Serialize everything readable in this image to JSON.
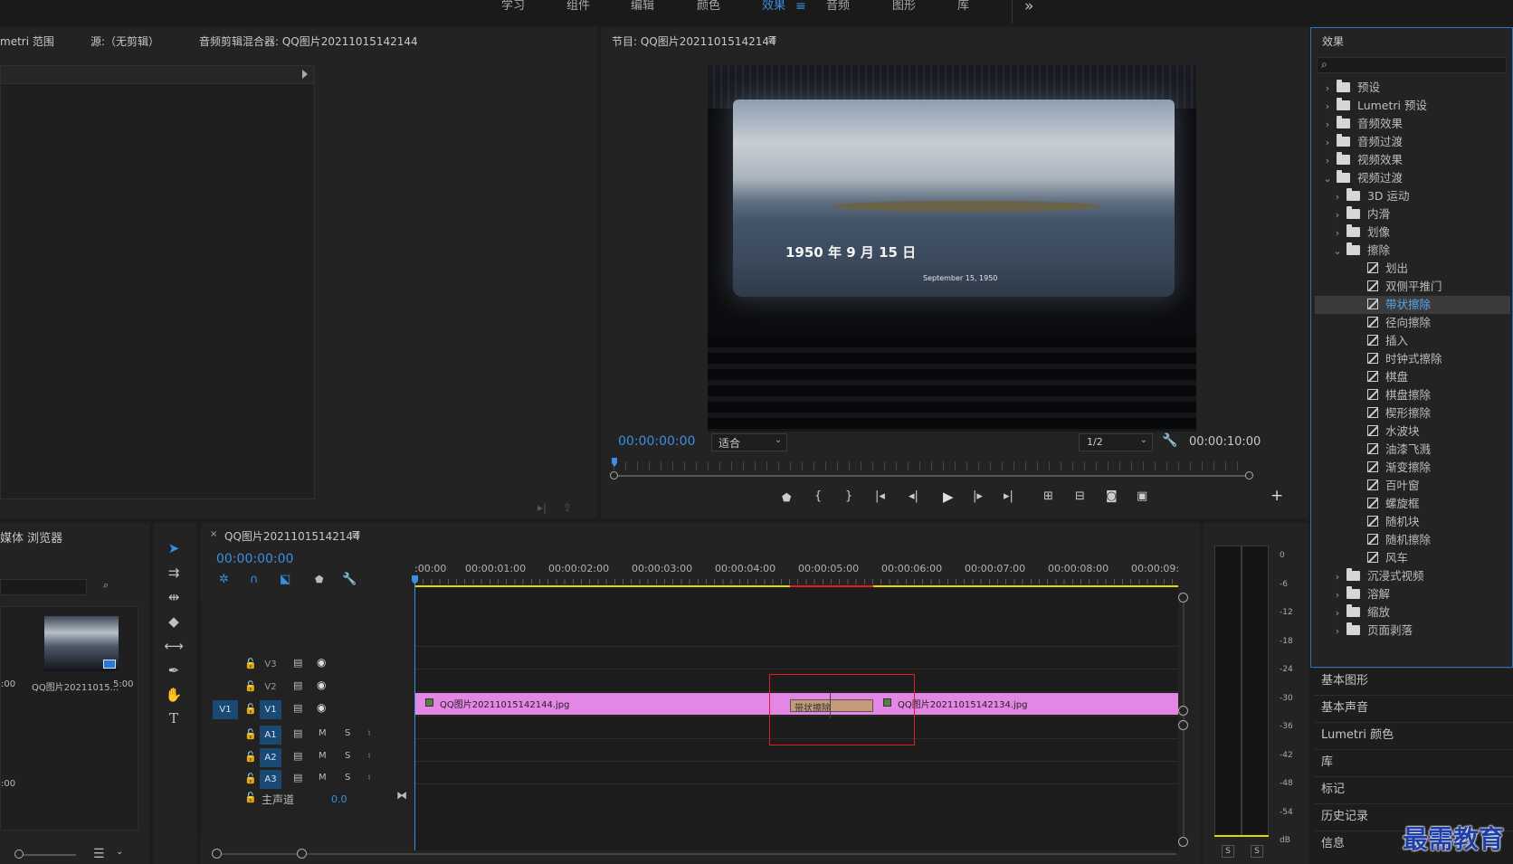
{
  "workspace_tabs": [
    {
      "label": "学习",
      "active": false
    },
    {
      "label": "组件",
      "active": false
    },
    {
      "label": "编辑",
      "active": false
    },
    {
      "label": "颜色",
      "active": false
    },
    {
      "label": "效果",
      "active": true
    },
    {
      "label": "音频",
      "active": false
    },
    {
      "label": "图形",
      "active": false
    },
    {
      "label": "库",
      "active": false
    }
  ],
  "workspace_overflow": "»",
  "source_panel": {
    "tabs": [
      "metri 范围",
      "源:（无剪辑）",
      "音频剪辑混合器: QQ图片20211015142144"
    ]
  },
  "program_monitor": {
    "title": "节目: QQ图片20211015142144",
    "timecode": "00:00:00:00",
    "duration": "00:00:10:00",
    "fit": "适合",
    "resolution": "1/2",
    "video_caption_zh": "1950 年 9 月 15 日",
    "video_caption_en": "September 15, 1950"
  },
  "media_browser": {
    "title": "媒体 浏览器",
    "thumb_label": "QQ图片20211015...",
    "thumb_duration": "5:00",
    "left_label_1": ":00",
    "left_label_2": ":00"
  },
  "timeline": {
    "sequence_name": "QQ图片20211015142144",
    "timecode": "00:00:00:00",
    "ruler": [
      ":00:00",
      "00:00:01:00",
      "00:00:02:00",
      "00:00:03:00",
      "00:00:04:00",
      "00:00:05:00",
      "00:00:06:00",
      "00:00:07:00",
      "00:00:08:00",
      "00:00:09:"
    ],
    "video_tracks": [
      "V3",
      "V2",
      "V1"
    ],
    "audio_tracks": [
      "A1",
      "A2",
      "A3"
    ],
    "source_patch_v": "V1",
    "master_label": "主声道",
    "master_value": "0.0",
    "mute_label": "M",
    "solo_label": "S",
    "clip1": "QQ图片20211015142144.jpg",
    "clip2": "QQ图片20211015142134.jpg",
    "transition": "带状擦除"
  },
  "meter": {
    "scale": [
      "0",
      "-6",
      "-12",
      "-18",
      "-24",
      "-30",
      "-36",
      "-42",
      "-48",
      "-54",
      "dB"
    ],
    "solo_buttons": [
      "S",
      "S"
    ]
  },
  "effects": {
    "title": "效果",
    "search_placeholder": "",
    "tree": [
      {
        "label": "预设",
        "type": "folder",
        "level": 0,
        "expanded": false
      },
      {
        "label": "Lumetri 预设",
        "type": "folder",
        "level": 0,
        "expanded": false
      },
      {
        "label": "音频效果",
        "type": "folder",
        "level": 0,
        "expanded": false
      },
      {
        "label": "音频过渡",
        "type": "folder",
        "level": 0,
        "expanded": false
      },
      {
        "label": "视频效果",
        "type": "folder",
        "level": 0,
        "expanded": false
      },
      {
        "label": "视频过渡",
        "type": "folder",
        "level": 0,
        "expanded": true
      },
      {
        "label": "3D 运动",
        "type": "folder",
        "level": 1,
        "expanded": false
      },
      {
        "label": "内滑",
        "type": "folder",
        "level": 1,
        "expanded": false
      },
      {
        "label": "划像",
        "type": "folder",
        "level": 1,
        "expanded": false
      },
      {
        "label": "擦除",
        "type": "folder",
        "level": 1,
        "expanded": true
      },
      {
        "label": "划出",
        "type": "effect",
        "level": 2
      },
      {
        "label": "双侧平推门",
        "type": "effect",
        "level": 2
      },
      {
        "label": "带状擦除",
        "type": "effect",
        "level": 2,
        "selected": true
      },
      {
        "label": "径向擦除",
        "type": "effect",
        "level": 2
      },
      {
        "label": "插入",
        "type": "effect",
        "level": 2
      },
      {
        "label": "时钟式擦除",
        "type": "effect",
        "level": 2
      },
      {
        "label": "棋盘",
        "type": "effect",
        "level": 2
      },
      {
        "label": "棋盘擦除",
        "type": "effect",
        "level": 2
      },
      {
        "label": "楔形擦除",
        "type": "effect",
        "level": 2
      },
      {
        "label": "水波块",
        "type": "effect",
        "level": 2
      },
      {
        "label": "油漆飞溅",
        "type": "effect",
        "level": 2
      },
      {
        "label": "渐变擦除",
        "type": "effect",
        "level": 2
      },
      {
        "label": "百叶窗",
        "type": "effect",
        "level": 2
      },
      {
        "label": "螺旋框",
        "type": "effect",
        "level": 2
      },
      {
        "label": "随机块",
        "type": "effect",
        "level": 2
      },
      {
        "label": "随机擦除",
        "type": "effect",
        "level": 2
      },
      {
        "label": "风车",
        "type": "effect",
        "level": 2
      },
      {
        "label": "沉浸式视频",
        "type": "folder",
        "level": 1,
        "expanded": false
      },
      {
        "label": "溶解",
        "type": "folder",
        "level": 1,
        "expanded": false
      },
      {
        "label": "缩放",
        "type": "folder",
        "level": 1,
        "expanded": false
      },
      {
        "label": "页面剥落",
        "type": "folder",
        "level": 1,
        "expanded": false
      }
    ]
  },
  "side_panels": [
    "基本图形",
    "基本声音",
    "Lumetri 颜色",
    "库",
    "标记",
    "历史记录",
    "信息"
  ],
  "watermark": "最需教育",
  "colors": {
    "accent": "#3a8fe0",
    "clip": "#e487e4",
    "transition": "#c49a7a",
    "selection_box": "#e02020",
    "work_area": "#e4d600"
  }
}
